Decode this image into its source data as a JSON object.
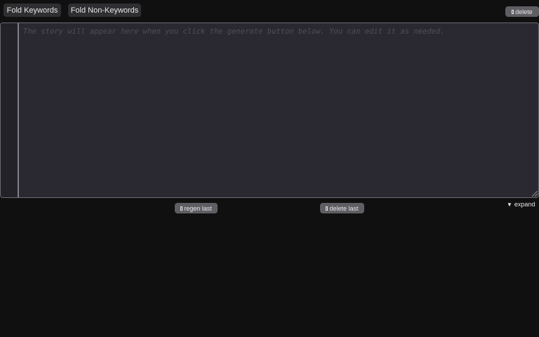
{
  "toolbar": {
    "fold_keywords_label": "Fold Keywords",
    "fold_non_keywords_label": "Fold Non-Keywords",
    "delete_label": "delete",
    "delete_icon": "box-glyph-icon"
  },
  "editor": {
    "placeholder": "The story will appear here when you click the generate button below. You can edit it as needed.",
    "value": ""
  },
  "actions": {
    "regen_last_label": "regen last",
    "regen_icon": "box-glyph-icon",
    "delete_last_label": "delete last",
    "delete_last_icon": "box-glyph-icon",
    "expand_label": "expand",
    "expand_icon": "▼"
  },
  "colors": {
    "background": "#111011",
    "editor_bg": "#2a2931",
    "button_dark": "#2f2f31",
    "button_gray": "#5e5e63"
  }
}
